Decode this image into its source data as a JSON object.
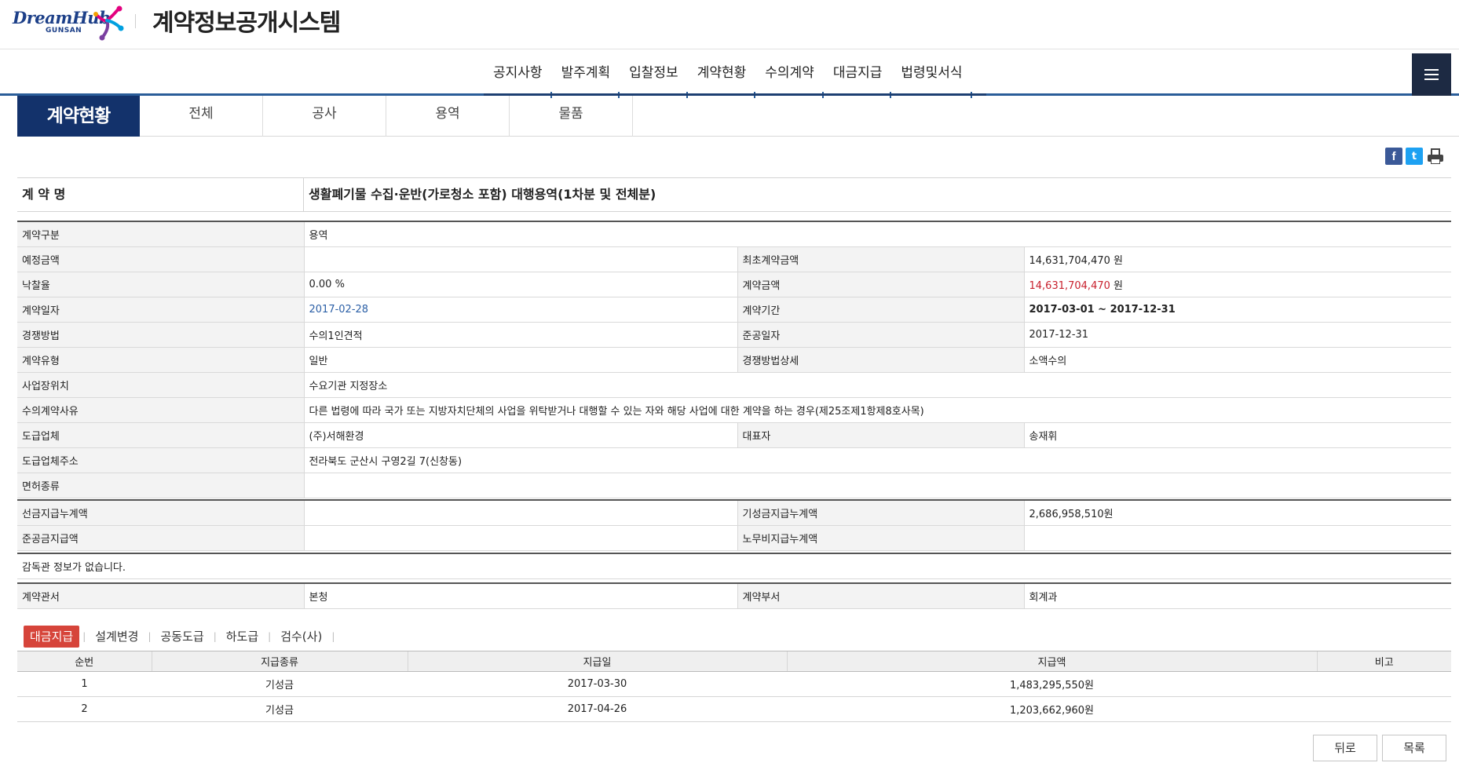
{
  "header": {
    "logo_dream": "DreamHub",
    "logo_gunsan": "GUNSAN",
    "title": "계약정보공개시스템"
  },
  "gnb": [
    "공지사항",
    "발주계획",
    "입찰정보",
    "계약현황",
    "수의계약",
    "대금지급",
    "법령및서식"
  ],
  "subnav": {
    "title": "계약현황",
    "tabs": [
      "전체",
      "공사",
      "용역",
      "물품"
    ]
  },
  "share": {
    "facebook": "f",
    "twitter": "t"
  },
  "contract": {
    "name_label": "계 약 명",
    "name_value": "생활폐기물 수집·운반(가로청소 포함) 대행용역(1차분 및 전체분)"
  },
  "info": {
    "type_label": "계약구분",
    "type_value": "용역",
    "est_label": "예정금액",
    "est_value": "",
    "init_amt_label": "최초계약금액",
    "init_amt_value": "14,631,704,470",
    "won": "원",
    "rate_label": "낙찰율",
    "rate_value": "0.00 %",
    "amt_label": "계약금액",
    "amt_value": "14,631,704,470",
    "date_label": "계약일자",
    "date_value": "2017-02-28",
    "period_label": "계약기간",
    "period_value": "2017-03-01 ~ 2017-12-31",
    "method_label": "경쟁방법",
    "method_value": "수의1인견적",
    "complete_label": "준공일자",
    "complete_value": "2017-12-31",
    "form_label": "계약유형",
    "form_value": "일반",
    "method_detail_label": "경쟁방법상세",
    "method_detail_value": "소액수의",
    "location_label": "사업장위치",
    "location_value": "수요기관 지정장소",
    "reason_label": "수의계약사유",
    "reason_value": "다른 법령에 따라 국가 또는 지방자치단체의 사업을 위탁받거나 대행할 수 있는 자와 해당 사업에 대한 계약을 하는 경우(제25조제1항제8호사목)",
    "contractor_label": "도급업체",
    "contractor_value": "(주)서해환경",
    "ceo_label": "대표자",
    "ceo_value": "송재휘",
    "addr_label": "도급업체주소",
    "addr_value": "전라북도 군산시 구영2길 7(신창동)",
    "license_label": "면허종류",
    "license_value": ""
  },
  "payments_summary": {
    "advance_label": "선금지급누계액",
    "advance_value": "",
    "progress_label": "기성금지급누계액",
    "progress_value": "2,686,958,510원",
    "final_label": "준공금지급액",
    "final_value": "",
    "labor_label": "노무비지급누계액",
    "labor_value": ""
  },
  "supervisor_note": "감독관 정보가 없습니다.",
  "office": {
    "office_label": "계약관서",
    "office_value": "본청",
    "dept_label": "계약부서",
    "dept_value": "회계과"
  },
  "pay_tabs": [
    "대금지급",
    "설계변경",
    "공동도급",
    "하도급",
    "검수(사)"
  ],
  "pay_table": {
    "headers": [
      "순번",
      "지급종류",
      "지급일",
      "지급액",
      "비고"
    ],
    "rows": [
      [
        "1",
        "기성금",
        "2017-03-30",
        "1,483,295,550원",
        ""
      ],
      [
        "2",
        "기성금",
        "2017-04-26",
        "1,203,662,960원",
        ""
      ]
    ]
  },
  "buttons": {
    "back": "뒤로",
    "list": "목록"
  },
  "colors": {
    "navy": "#13326b",
    "gnb_line": "#2a5d99",
    "accent_red": "#d6443a",
    "amount_red": "#c8202d",
    "date_blue": "#2b5fa6"
  }
}
